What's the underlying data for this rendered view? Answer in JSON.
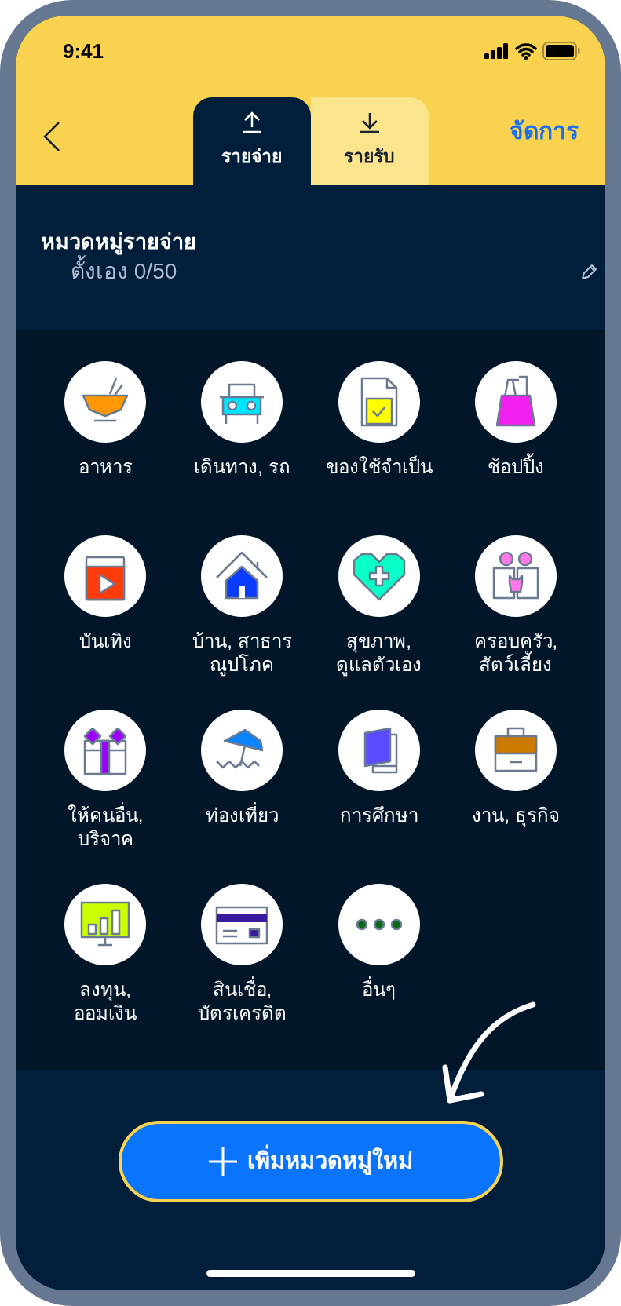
{
  "status_bar": {
    "time": "9:41"
  },
  "header": {
    "tabs": [
      {
        "label": "รายจ่าย",
        "selected": true
      },
      {
        "label": "รายรับ",
        "selected": false
      }
    ],
    "action": "จัดการ"
  },
  "section": {
    "title": "หมวดหมู่รายจ่าย",
    "subtitle": "ตั้งเอง 0/50"
  },
  "categories": [
    {
      "label": "อาหาร"
    },
    {
      "label": "เดินทาง, รถ"
    },
    {
      "label": "ของใช้จำเป็น"
    },
    {
      "label": "ช้อปปิ้ง"
    },
    {
      "label": "บันเทิง"
    },
    {
      "label": "บ้าน, สาธาร\nณูปโภค"
    },
    {
      "label": "สุขภาพ,\nดูแลตัวเอง"
    },
    {
      "label": "ครอบครัว,\nสัตว์เลี้ยง"
    },
    {
      "label": "ให้คนอื่น,\nบริจาค"
    },
    {
      "label": "ท่องเที่ยว"
    },
    {
      "label": "การศึกษา"
    },
    {
      "label": "งาน, ธุรกิจ"
    },
    {
      "label": "ลงทุน,\nออมเงิน"
    },
    {
      "label": "สินเชื่อ,\nบัตรเครดิต"
    },
    {
      "label": "อื่นๆ"
    }
  ],
  "add_button": {
    "label": "เพิ่มหมวดหมู่ใหม่"
  }
}
